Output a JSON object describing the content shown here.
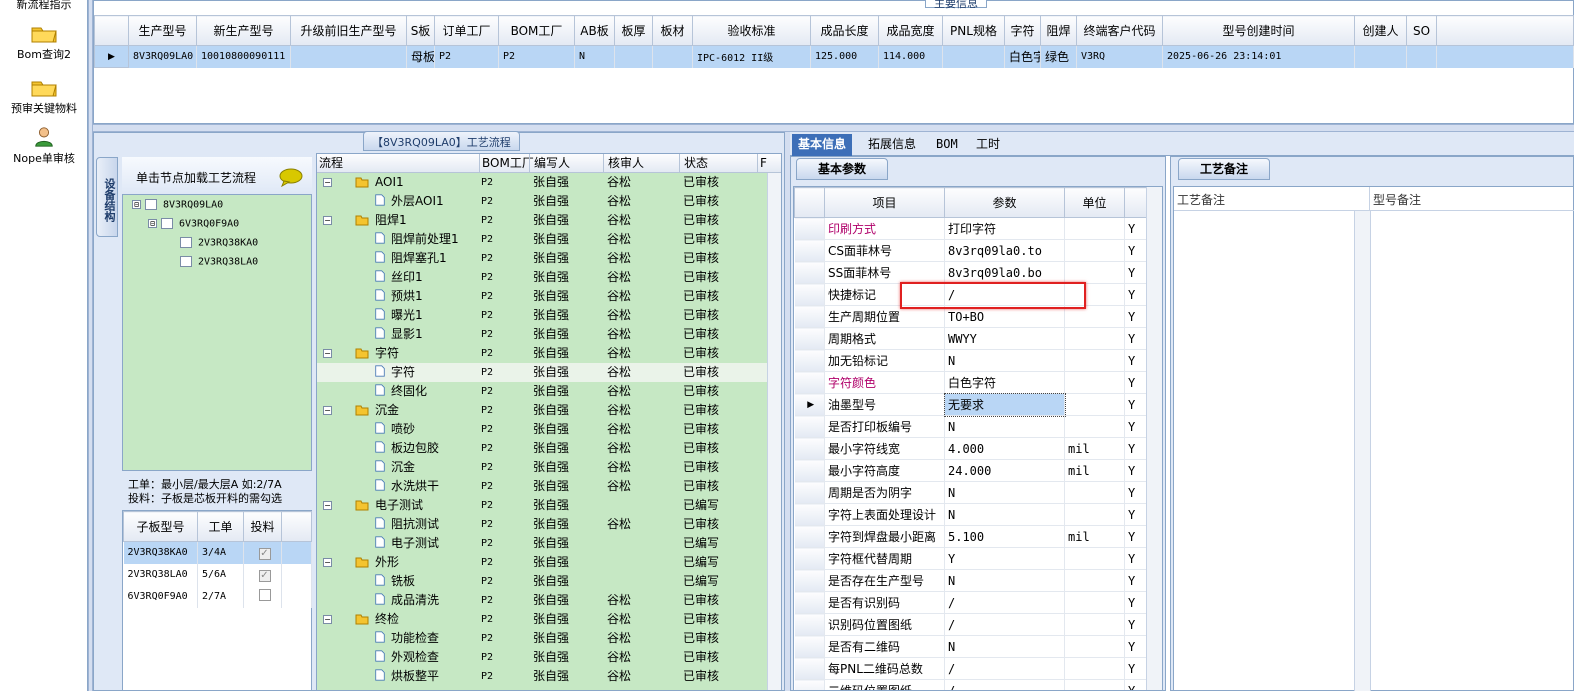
{
  "leftnav": {
    "items": [
      {
        "label": "新流程指示",
        "icon": "folder-icon"
      },
      {
        "label": "Bom查询2",
        "icon": "folder-icon"
      },
      {
        "label": "预审关键物料",
        "icon": "folder-icon"
      },
      {
        "label": "Nope单审核",
        "icon": "user-icon"
      }
    ]
  },
  "top": {
    "title": "主要信息",
    "columns": [
      "生产型号",
      "新生产型号",
      "升级前旧生产型号",
      "S板",
      "订单工厂",
      "BOM工厂",
      "AB板",
      "板厚",
      "板材",
      "验收标准",
      "成品长度",
      "成品宽度",
      "PNL规格",
      "字符",
      "阻焊",
      "终端客户代码",
      "型号创建时间",
      "创建人",
      "SO"
    ],
    "row": [
      "8V3RQ09LA0",
      "10010800090111",
      "",
      "母板",
      "P2",
      "P2",
      "N",
      "",
      "",
      "IPC-6012 II级",
      "125.000",
      "114.000",
      "",
      "白色字符",
      "绿色",
      "V3RQ",
      "2025-06-26 23:14:01",
      "",
      ""
    ]
  },
  "process": {
    "title": "【8V3RQ09LA0】工艺流程",
    "side_tab": "设备结构",
    "load_label": "单击节点加载工艺流程",
    "tree": [
      {
        "label": "8V3RQ09LA0",
        "level": 0,
        "toggle": "⊟"
      },
      {
        "label": "6V3RQ0F9A0",
        "level": 1,
        "toggle": "⊟"
      },
      {
        "label": "2V3RQ38KA0",
        "level": 2,
        "toggle": ""
      },
      {
        "label": "2V3RQ38LA0",
        "level": 2,
        "toggle": ""
      }
    ],
    "note1": "工单：最小层/最大层A 如:2/7A",
    "note2": "投料：子板是芯板开料的需勾选",
    "sub_columns": [
      "子板型号",
      "工单",
      "投料"
    ],
    "sub_rows": [
      {
        "model": "2V3RQ38KA0",
        "order": "3/4A",
        "checked": true
      },
      {
        "model": "2V3RQ38LA0",
        "order": "5/6A",
        "checked": true
      },
      {
        "model": "6V3RQ0F9A0",
        "order": "2/7A",
        "checked": false
      }
    ],
    "flow_columns": [
      "流程",
      "BOM工厂",
      "编写人",
      "核审人",
      "状态",
      "F"
    ],
    "flow_rows": [
      {
        "name": "AOI1",
        "type": "folder",
        "f": "P2",
        "w": "张自强",
        "r": "谷松",
        "s": "已审核"
      },
      {
        "name": "外层AOI1",
        "type": "file",
        "f": "P2",
        "w": "张自强",
        "r": "谷松",
        "s": "已审核"
      },
      {
        "name": "阻焊1",
        "type": "folder",
        "f": "P2",
        "w": "张自强",
        "r": "谷松",
        "s": "已审核"
      },
      {
        "name": "阻焊前处理1",
        "type": "file",
        "f": "P2",
        "w": "张自强",
        "r": "谷松",
        "s": "已审核"
      },
      {
        "name": "阻焊塞孔1",
        "type": "file",
        "f": "P2",
        "w": "张自强",
        "r": "谷松",
        "s": "已审核"
      },
      {
        "name": "丝印1",
        "type": "file",
        "f": "P2",
        "w": "张自强",
        "r": "谷松",
        "s": "已审核"
      },
      {
        "name": "预烘1",
        "type": "file",
        "f": "P2",
        "w": "张自强",
        "r": "谷松",
        "s": "已审核"
      },
      {
        "name": "曝光1",
        "type": "file",
        "f": "P2",
        "w": "张自强",
        "r": "谷松",
        "s": "已审核"
      },
      {
        "name": "显影1",
        "type": "file",
        "f": "P2",
        "w": "张自强",
        "r": "谷松",
        "s": "已审核"
      },
      {
        "name": "字符",
        "type": "folder",
        "f": "P2",
        "w": "张自强",
        "r": "谷松",
        "s": "已审核"
      },
      {
        "name": "字符",
        "type": "file",
        "f": "P2",
        "w": "张自强",
        "r": "谷松",
        "s": "已审核",
        "selected": true
      },
      {
        "name": "终固化",
        "type": "file",
        "f": "P2",
        "w": "张自强",
        "r": "谷松",
        "s": "已审核"
      },
      {
        "name": "沉金",
        "type": "folder",
        "f": "P2",
        "w": "张自强",
        "r": "谷松",
        "s": "已审核"
      },
      {
        "name": "喷砂",
        "type": "file",
        "f": "P2",
        "w": "张自强",
        "r": "谷松",
        "s": "已审核"
      },
      {
        "name": "板边包胶",
        "type": "file",
        "f": "P2",
        "w": "张自强",
        "r": "谷松",
        "s": "已审核"
      },
      {
        "name": "沉金",
        "type": "file",
        "f": "P2",
        "w": "张自强",
        "r": "谷松",
        "s": "已审核"
      },
      {
        "name": "水洗烘干",
        "type": "file",
        "f": "P2",
        "w": "张自强",
        "r": "谷松",
        "s": "已审核"
      },
      {
        "name": "电子测试",
        "type": "folder",
        "f": "P2",
        "w": "张自强",
        "r": "",
        "s": "已编写"
      },
      {
        "name": "阻抗测试",
        "type": "file",
        "f": "P2",
        "w": "张自强",
        "r": "谷松",
        "s": "已审核"
      },
      {
        "name": "电子测试",
        "type": "file",
        "f": "P2",
        "w": "张自强",
        "r": "",
        "s": "已编写"
      },
      {
        "name": "外形",
        "type": "folder",
        "f": "P2",
        "w": "张自强",
        "r": "",
        "s": "已编写"
      },
      {
        "name": "铣板",
        "type": "file",
        "f": "P2",
        "w": "张自强",
        "r": "",
        "s": "已编写"
      },
      {
        "name": "成品清洗",
        "type": "file",
        "f": "P2",
        "w": "张自强",
        "r": "谷松",
        "s": "已审核"
      },
      {
        "name": "终检",
        "type": "folder",
        "f": "P2",
        "w": "张自强",
        "r": "谷松",
        "s": "已审核"
      },
      {
        "name": "功能检查",
        "type": "file",
        "f": "P2",
        "w": "张自强",
        "r": "谷松",
        "s": "已审核"
      },
      {
        "name": "外观检查",
        "type": "file",
        "f": "P2",
        "w": "张自强",
        "r": "谷松",
        "s": "已审核"
      },
      {
        "name": "烘板整平",
        "type": "file",
        "f": "P2",
        "w": "张自强",
        "r": "谷松",
        "s": "已审核"
      }
    ]
  },
  "right": {
    "tabs": [
      "基本信息",
      "拓展信息",
      "BOM",
      "工时"
    ],
    "basic_tab": "基本参数",
    "param_columns": [
      "项目",
      "参数",
      "单位",
      "Y"
    ],
    "params": [
      {
        "k": "印刷方式",
        "v": "打印字符",
        "u": "",
        "y": "Y",
        "pink": true
      },
      {
        "k": "CS面菲林号",
        "v": "8v3rq09la0.to",
        "u": "",
        "y": "Y"
      },
      {
        "k": "SS面菲林号",
        "v": "8v3rq09la0.bo",
        "u": "",
        "y": "Y"
      },
      {
        "k": "快捷标记",
        "v": "/",
        "u": "",
        "y": "Y"
      },
      {
        "k": "生产周期位置",
        "v": "TO+BO",
        "u": "",
        "y": "Y"
      },
      {
        "k": "周期格式",
        "v": "WWYY",
        "u": "",
        "y": "Y"
      },
      {
        "k": "加无铅标记",
        "v": "N",
        "u": "",
        "y": "Y"
      },
      {
        "k": "字符颜色",
        "v": "白色字符",
        "u": "",
        "y": "Y",
        "pink": true
      },
      {
        "k": "油墨型号",
        "v": "无要求",
        "u": "",
        "y": "Y",
        "current": true
      },
      {
        "k": "是否打印板编号",
        "v": "N",
        "u": "",
        "y": "Y"
      },
      {
        "k": "最小字符线宽",
        "v": "4.000",
        "u": "mil",
        "y": "Y"
      },
      {
        "k": "最小字符高度",
        "v": "24.000",
        "u": "mil",
        "y": "Y"
      },
      {
        "k": "周期是否为阴字",
        "v": "N",
        "u": "",
        "y": "Y"
      },
      {
        "k": "字符上表面处理设计",
        "v": "N",
        "u": "",
        "y": "Y"
      },
      {
        "k": "字符到焊盘最小距离",
        "v": "5.100",
        "u": "mil",
        "y": "Y"
      },
      {
        "k": "字符框代替周期",
        "v": "Y",
        "u": "",
        "y": "Y"
      },
      {
        "k": "是否存在生产型号",
        "v": "N",
        "u": "",
        "y": "Y"
      },
      {
        "k": "是否有识别码",
        "v": "/",
        "u": "",
        "y": "Y"
      },
      {
        "k": "识别码位置图纸",
        "v": "/",
        "u": "",
        "y": "Y"
      },
      {
        "k": "是否有二维码",
        "v": "N",
        "u": "",
        "y": "Y"
      },
      {
        "k": "每PNL二维码总数",
        "v": "/",
        "u": "",
        "y": "Y"
      },
      {
        "k": "二维码位置图纸",
        "v": "/",
        "u": "",
        "y": "Y"
      }
    ],
    "gy_tab": "工艺备注",
    "gy_cols": [
      "工艺备注",
      "型号备注"
    ]
  },
  "colors": {
    "green": "#c6e8c4",
    "panel": "#dfe8f6",
    "selection": "#b9d6f5",
    "highlight": "#e02020",
    "pink_label": "#b0006a"
  }
}
